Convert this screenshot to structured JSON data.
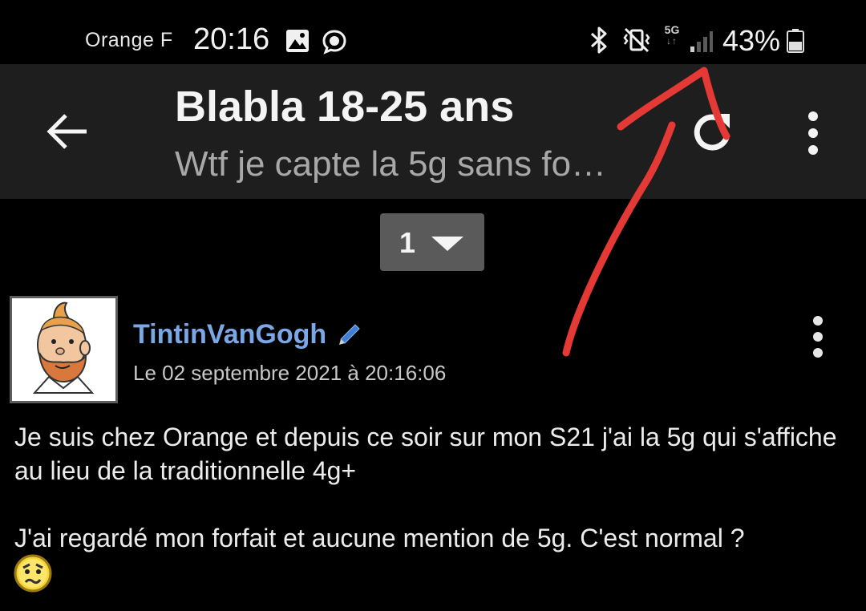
{
  "status_bar": {
    "carrier": "Orange F",
    "time": "20:16",
    "network_type": "5G",
    "battery_percent": "43%",
    "signal_level": 0.25,
    "battery_level": 0.43,
    "icons": [
      "gallery-icon",
      "chat-bubble-icon",
      "bluetooth-icon",
      "vibrate-mute-icon",
      "5g-icon",
      "signal-icon",
      "battery-icon"
    ]
  },
  "app_bar": {
    "title": "Blabla 18-25 ans",
    "subtitle": "Wtf je capte la 5g sans fo…",
    "background": "#1e1e1e",
    "icons": [
      "back-arrow-icon",
      "refresh-icon",
      "more-vert-icon"
    ]
  },
  "pagination": {
    "current_page": "1",
    "background": "#5a5a5a"
  },
  "post": {
    "author": "TintinVanGogh",
    "author_color": "#7aa7e6",
    "date": "Le 02 septembre 2021 à 20:16:06",
    "paragraphs": [
      "Je suis chez Orange et depuis ce soir sur mon S21 j'ai la 5g qui s'affiche au lieu de la traditionnelle 4g+",
      "J'ai regardé mon forfait et aucune mention de 5g. C'est normal ?"
    ],
    "icons": [
      "avatar-image",
      "pencil-icon",
      "more-vert-icon",
      "confused-smiley-icon"
    ]
  },
  "annotation": {
    "color": "#e53935",
    "description_icons": [
      "red-arrow-annotation"
    ]
  }
}
